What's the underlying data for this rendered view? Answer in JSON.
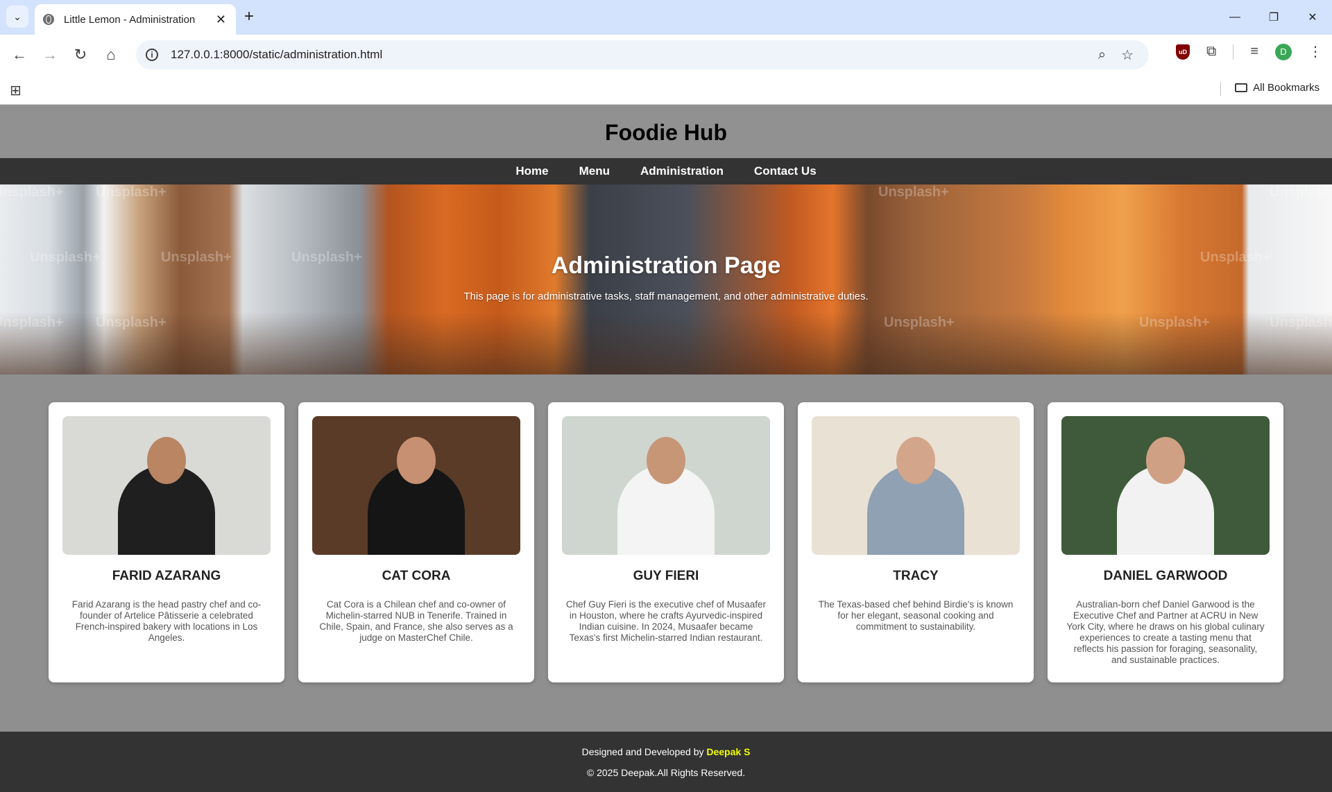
{
  "browser": {
    "tab_title": "Little Lemon - Administration",
    "url": "127.0.0.1:8000/static/administration.html",
    "bookmarks_label": "All Bookmarks",
    "profile_initial": "D",
    "extension_label": "uD"
  },
  "site": {
    "title": "Foodie Hub",
    "nav": [
      "Home",
      "Menu",
      "Administration",
      "Contact Us"
    ]
  },
  "hero": {
    "title": "Administration Page",
    "subtitle": "This page is for administrative tasks, staff management, and other administrative duties.",
    "watermark": "Unsplash+"
  },
  "chefs": [
    {
      "name": "FARID AZARANG",
      "bio": "Farid Azarang is the head pastry chef and co-founder of Artelice Pâtisserie a celebrated French-inspired bakery with locations in Los Angeles.",
      "photo_bg": "#d9d9d6",
      "photo_outfit": "#1f1f1f",
      "photo_skin": "#b98563"
    },
    {
      "name": "CAT CORA",
      "bio": "Cat Cora is a Chilean chef and co-owner of Michelin-starred NUB in Tenerife. Trained in Chile, Spain, and France, she also serves as a judge on MasterChef Chile.",
      "photo_bg": "#5a3b28",
      "photo_outfit": "#151515",
      "photo_skin": "#c89072"
    },
    {
      "name": "GUY FIERI",
      "bio": "Chef Guy Fieri is the executive chef of Musaafer in Houston, where he crafts Ayurvedic-inspired Indian cuisine. In 2024, Musaafer became Texas's first Michelin-starred Indian restaurant.",
      "photo_bg": "#cfd6cf",
      "photo_outfit": "#f4f4f4",
      "photo_skin": "#c79677"
    },
    {
      "name": "TRACY",
      "bio": "The Texas-based chef behind Birdie's is known for her elegant, seasonal cooking and commitment to sustainability.",
      "photo_bg": "#e9e1d4",
      "photo_outfit": "#8fa1b2",
      "photo_skin": "#d3a58a"
    },
    {
      "name": "DANIEL GARWOOD",
      "bio": "Australian-born chef Daniel Garwood is the Executive Chef and Partner at ACRU in New York City, where he draws on his global culinary experiences to create a tasting menu that reflects his passion for foraging, seasonality, and sustainable practices.",
      "photo_bg": "#3e5a3a",
      "photo_outfit": "#f2f2f2",
      "photo_skin": "#d0a084"
    }
  ],
  "footer": {
    "designed_prefix": "Designed and Developed by",
    "designer": "Deepak S",
    "copyright": "© 2025 Deepak.All Rights Reserved."
  }
}
